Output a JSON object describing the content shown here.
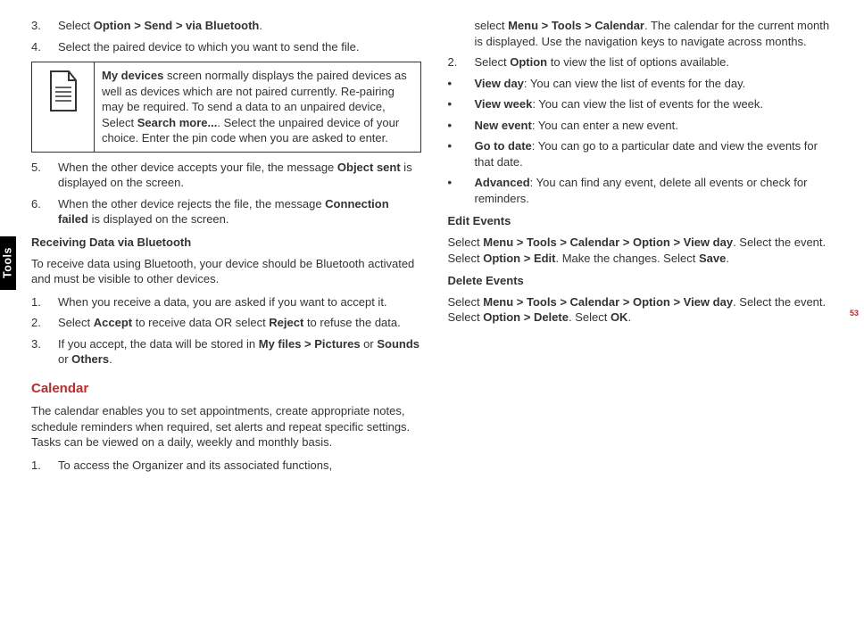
{
  "sideTab": "Tools",
  "pageNumber": "53",
  "left": {
    "steps_a": [
      {
        "n": "3.",
        "pre": "Select ",
        "b": "Option > Send > via Bluetooth",
        "post": "."
      },
      {
        "n": "4.",
        "pre": "Select the paired device to which you want to send the file.",
        "b": "",
        "post": ""
      }
    ],
    "note": {
      "t1": "My devices",
      "t2": " screen normally displays the paired devices as well as devices which are not paired currently. Re-pairing may be required. To send a data to an unpaired device, Select ",
      "t3": "Search more...",
      "t4": ". Select the unpaired device of your choice. Enter the pin code when you are asked to enter."
    },
    "steps_b": [
      {
        "n": "5.",
        "pre": "When the other device accepts your file, the message ",
        "b": "Object sent",
        "post": " is displayed on the screen."
      },
      {
        "n": "6.",
        "pre": "When the other device rejects the file, the message ",
        "b": "Connection failed",
        "post": " is displayed on the screen."
      }
    ],
    "recvHead": "Receiving Data via Bluetooth",
    "recvIntro": "To receive data using Bluetooth, your device should be Bluetooth activated and must be visible to other devices.",
    "recvSteps": {
      "s1": {
        "n": "1.",
        "t": "When you receive a data, you are asked if you want to accept it."
      },
      "s2": {
        "n": "2.",
        "p1": "Select ",
        "b1": "Accept",
        "p2": " to receive data OR select ",
        "b2": "Reject",
        "p3": " to refuse the data."
      },
      "s3": {
        "n": "3.",
        "p1": "If you accept, the data will be stored in ",
        "b1": "My files > Pictures",
        "p2": " or ",
        "b2": "Sounds",
        "p3": " or ",
        "b3": "Others",
        "p4": "."
      }
    },
    "calHead": "Calendar",
    "calIntro": "The calendar enables you to set appointments, create appropriate notes, schedule reminders when required, set alerts and repeat specific settings. Tasks can be viewed on a daily, weekly and monthly basis.",
    "calStep1": {
      "n": "1.",
      "t": "To access the Organizer and its associated functions,"
    }
  },
  "right": {
    "cont": {
      "p1": "select ",
      "b1": "Menu > Tools > Calendar",
      "p2": ". The calendar for the current month is displayed. Use the navigation keys to navigate across months."
    },
    "step2": {
      "n": "2.",
      "p1": "Select ",
      "b1": "Option",
      "p2": " to view the list of options available."
    },
    "bullets": [
      {
        "b": "View day",
        "t": ": You can view the list of events for the day."
      },
      {
        "b": "View week",
        "t": ": You can view the list of events for the week."
      },
      {
        "b": "New event",
        "t": ": You can enter a new event."
      },
      {
        "b": "Go to date",
        "t": ": You can go to a particular date and view the events for that date."
      },
      {
        "b": "Advanced",
        "t": ": You can find any event, delete all events or check for reminders."
      }
    ],
    "editHead": "Edit Events",
    "editPara": {
      "p1": "Select ",
      "b1": "Menu > Tools > Calendar > Option > View day",
      "p2": ". Select the event. Select ",
      "b2": "Option > Edit",
      "p3": ". Make the changes. Select ",
      "b3": "Save",
      "p4": "."
    },
    "delHead": "Delete Events",
    "delPara": {
      "p1": "Select ",
      "b1": "Menu > Tools > Calendar > Option > View day",
      "p2": ". Select the event. Select ",
      "b2": "Option > Delete",
      "p3": ".  Select ",
      "b3": "OK",
      "p4": "."
    }
  }
}
